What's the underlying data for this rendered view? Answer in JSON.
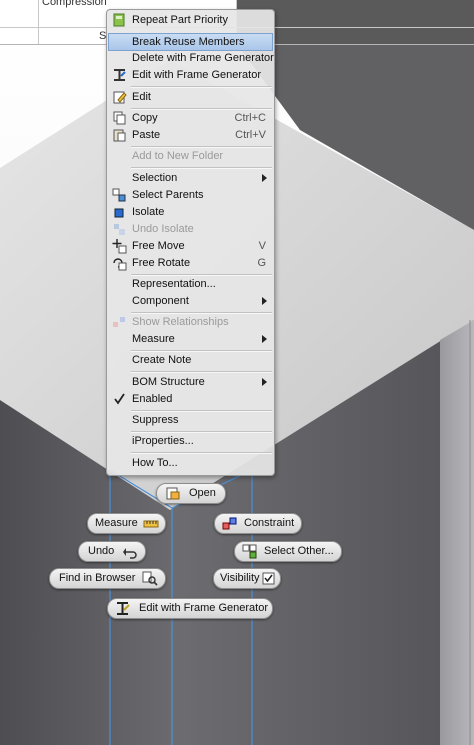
{
  "browser_table": {
    "row_text": "Compression",
    "col_fragment": "S"
  },
  "context_menu": {
    "items": [
      {
        "label": "Repeat Part Priority",
        "icon": "part-priority-icon"
      },
      {
        "label": "Break Reuse Members",
        "highlighted": true
      },
      {
        "label": "Delete with Frame Generator"
      },
      {
        "label": "Edit with Frame Generator",
        "icon": "frame-generator-icon"
      },
      {
        "label": "Edit",
        "icon": "edit-icon"
      },
      {
        "label": "Copy",
        "shortcut": "Ctrl+C",
        "icon": "copy-icon"
      },
      {
        "label": "Paste",
        "shortcut": "Ctrl+V",
        "icon": "paste-icon"
      },
      {
        "label": "Add to New Folder",
        "disabled": true
      },
      {
        "label": "Selection",
        "submenu": true
      },
      {
        "label": "Select Parents",
        "icon": "select-parents-icon"
      },
      {
        "label": "Isolate",
        "icon": "isolate-icon"
      },
      {
        "label": "Undo Isolate",
        "disabled": true,
        "icon": "undo-isolate-icon"
      },
      {
        "label": "Free Move",
        "shortcut": "V",
        "icon": "free-move-icon"
      },
      {
        "label": "Free Rotate",
        "shortcut": "G",
        "icon": "free-rotate-icon"
      },
      {
        "label": "Representation..."
      },
      {
        "label": "Component",
        "submenu": true
      },
      {
        "label": "Show Relationships",
        "disabled": true,
        "icon": "relationships-icon"
      },
      {
        "label": "Measure",
        "submenu": true
      },
      {
        "label": "Create Note"
      },
      {
        "label": "BOM Structure",
        "submenu": true
      },
      {
        "label": "Enabled",
        "checked": true
      },
      {
        "label": "Suppress"
      },
      {
        "label": "iProperties..."
      },
      {
        "label": "How To..."
      }
    ]
  },
  "marking_menu": {
    "open": "Open",
    "measure": "Measure",
    "constraint": "Constraint",
    "undo": "Undo",
    "select_other": "Select Other...",
    "find_in_browser": "Find in Browser",
    "visibility": "Visibility",
    "edit_frame": "Edit with Frame Generator"
  },
  "colors": {
    "highlight": "#b7d0ee",
    "viewport_dark": "#5b5b5f",
    "viewport_top": "#d6d6d6",
    "edge_blue": "#4a8fd8"
  }
}
